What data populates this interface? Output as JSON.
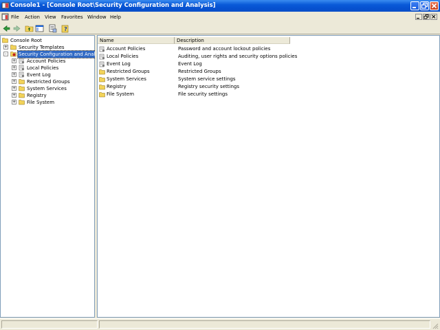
{
  "window": {
    "title": "Console1 - [Console Root\\Security Configuration and Analysis]"
  },
  "menu": {
    "items": [
      "File",
      "Action",
      "View",
      "Favorites",
      "Window",
      "Help"
    ]
  },
  "toolbar": {
    "icons": [
      "back-icon",
      "forward-icon",
      "up-folder-icon",
      "show-hide-tree-icon",
      "export-list-icon",
      "help-icon"
    ]
  },
  "tree": {
    "root": "Console Root",
    "nodes": [
      {
        "label": "Security Templates",
        "icon": "folder-icon",
        "expander": "+"
      },
      {
        "label": "Security Configuration and Analysis",
        "icon": "security-config-icon",
        "expander": "-"
      },
      {
        "label": "Account Policies",
        "icon": "policy-icon",
        "expander": "+"
      },
      {
        "label": "Local Policies",
        "icon": "policy-icon",
        "expander": "+"
      },
      {
        "label": "Event Log",
        "icon": "policy-icon",
        "expander": "+"
      },
      {
        "label": "Restricted Groups",
        "icon": "folder-icon",
        "expander": "+"
      },
      {
        "label": "System Services",
        "icon": "folder-icon",
        "expander": "+"
      },
      {
        "label": "Registry",
        "icon": "folder-icon",
        "expander": "+"
      },
      {
        "label": "File System",
        "icon": "folder-icon",
        "expander": "+"
      }
    ]
  },
  "list": {
    "columns": [
      "Name",
      "Description"
    ],
    "rows": [
      {
        "name": "Account Policies",
        "description": "Password and account lockout policies",
        "icon": "policy-icon"
      },
      {
        "name": "Local Policies",
        "description": "Auditing, user rights and security options policies",
        "icon": "policy-icon"
      },
      {
        "name": "Event Log",
        "description": "Event Log",
        "icon": "policy-icon"
      },
      {
        "name": "Restricted Groups",
        "description": "Restricted Groups",
        "icon": "folder-icon"
      },
      {
        "name": "System Services",
        "description": "System service settings",
        "icon": "folder-icon"
      },
      {
        "name": "Registry",
        "description": "Registry security settings",
        "icon": "folder-icon"
      },
      {
        "name": "File System",
        "description": "File security settings",
        "icon": "folder-icon"
      }
    ]
  },
  "colors": {
    "titlebar": "#0a5ad8",
    "selection": "#316ac5",
    "chrome": "#ece9d8",
    "folder": "#f2d35a"
  }
}
